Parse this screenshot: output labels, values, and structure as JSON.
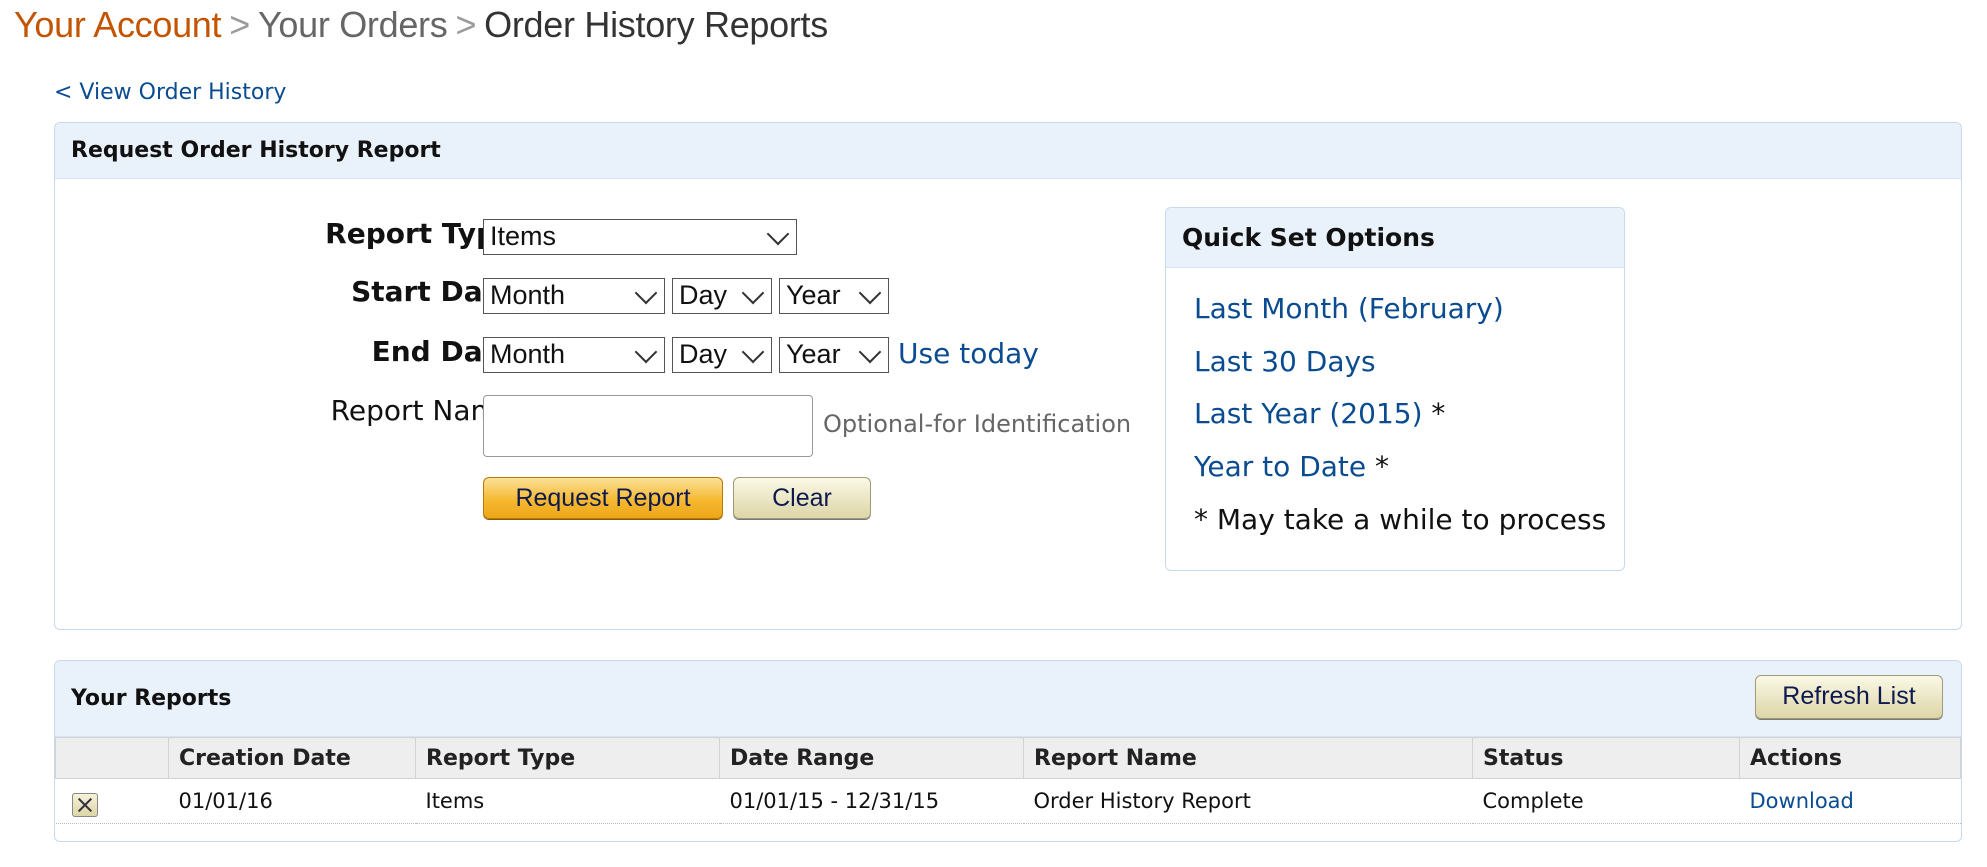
{
  "breadcrumb": {
    "account": "Your Account",
    "orders": "Your Orders",
    "current": "Order History Reports",
    "separator": ">"
  },
  "back_link": "< View Order History",
  "request_panel": {
    "title": "Request Order History Report",
    "report_type_label": "Report Type",
    "report_type_value": "Items",
    "start_date_label": "Start Date",
    "end_date_label": "End Date",
    "month_value": "Month",
    "day_value": "Day",
    "year_value": "Year",
    "use_today": "Use today",
    "report_name_label": "Report Name",
    "report_name_value": "",
    "report_name_hint": "Optional-for Identification",
    "request_button": "Request Report",
    "clear_button": "Clear"
  },
  "quick_set": {
    "title": "Quick Set Options",
    "last_month": "Last Month (February)",
    "last_30_days": "Last 30 Days",
    "last_year": "Last Year (2015)",
    "year_to_date": "Year to Date",
    "star": "*",
    "note": "* May take a while to process"
  },
  "reports_panel": {
    "title": "Your Reports",
    "refresh_button": "Refresh List",
    "columns": [
      "",
      "Creation Date",
      "Report Type",
      "Date Range",
      "Report Name",
      "Status",
      "Actions"
    ],
    "rows": [
      {
        "creation_date": "01/01/16",
        "report_type": "Items",
        "date_range": "01/01/15 - 12/31/15",
        "report_name": "Order History Report",
        "status": "Complete",
        "action": "Download"
      }
    ]
  },
  "colors": {
    "link": "#0b4c90",
    "breadcrumb_account": "#c45500",
    "panel_header_bg": "#e9f1fb",
    "primary_button": "#f5b931"
  }
}
